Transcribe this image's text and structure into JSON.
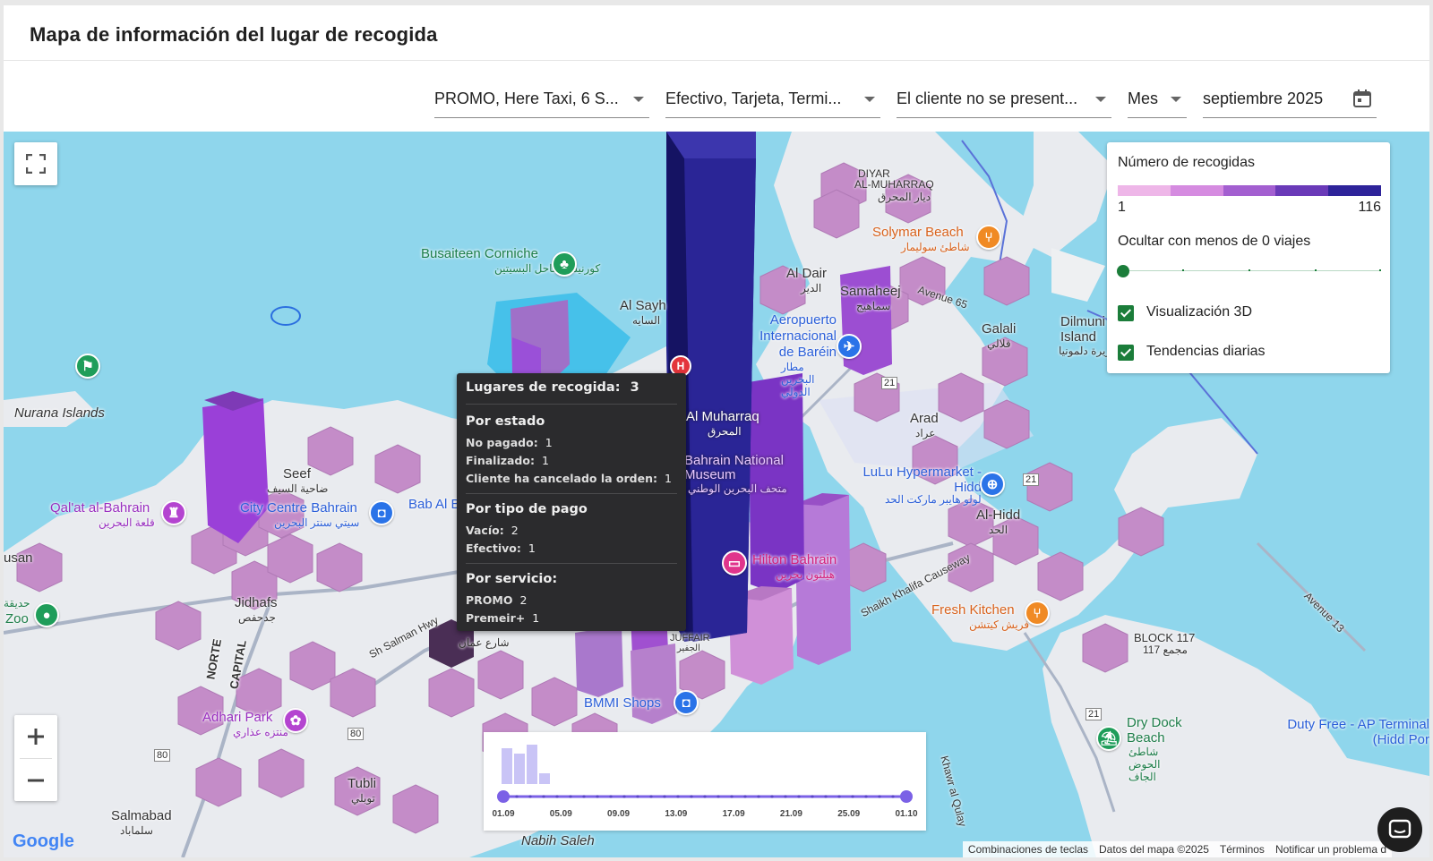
{
  "title": "Mapa de información del lugar de recogida",
  "filters": {
    "service": "PROMO, Here Taxi, 6 S...",
    "payment": "Efectivo, Tarjeta, Termi...",
    "status": "El cliente no se present...",
    "period": "Mes",
    "date": "septiembre 2025",
    "calendar_icon": "calendar-icon"
  },
  "legend": {
    "title": "Número de recogidas",
    "min": "1",
    "max": "116",
    "colors": [
      "#eeb6e8",
      "#d58be0",
      "#a35fd0",
      "#6a3ab8",
      "#2e239a"
    ],
    "hide_label": "Ocultar con menos de 0 viajes",
    "min_trips_value": 0,
    "toggle_3d": "Visualización 3D",
    "toggle_3d_checked": true,
    "toggle_trends": "Tendencias diarias",
    "toggle_trends_checked": true
  },
  "tooltip": {
    "places_label": "Lugares de recogida:",
    "places_value": "3",
    "by_status_title": "Por estado",
    "status": [
      {
        "label": "No pagado:",
        "value": "1"
      },
      {
        "label": "Finalizado:",
        "value": "1"
      },
      {
        "label": "Cliente ha cancelado la orden:",
        "value": "1"
      }
    ],
    "by_payment_title": "Por tipo de pago",
    "payment": [
      {
        "label": "Vacío:",
        "value": "2"
      },
      {
        "label": "Efectivo:",
        "value": "1"
      }
    ],
    "by_service_title": "Por servicio:",
    "service": [
      {
        "label": "PROMO",
        "value": "2"
      },
      {
        "label": "Premeir+",
        "value": "1"
      }
    ]
  },
  "timeline": {
    "ticks": [
      "01.09",
      "05.09",
      "09.09",
      "13.09",
      "17.09",
      "21.09",
      "25.09",
      "01.10"
    ],
    "range_start": "01.09",
    "range_end": "01.10",
    "accent": "#7b61e6"
  },
  "map_labels": {
    "diyar": "DIYAR",
    "al_muharraq_district": "AL-MUHARRAQ",
    "diyar_ar": "ديار المحرق",
    "solymar": "Solymar Beach",
    "solymar_ar": "شاطئ سوليمار",
    "busaiteen": "Busaiteen Corniche",
    "busaiteen_ar": "كورنيش ساحل البسيتين",
    "al_dair": "Al Dair",
    "al_dair_ar": "الدير",
    "samaheej": "Samaheej",
    "samaheej_ar": "سماهيج",
    "avenue65": "Avenue 65",
    "al_sayh": "Al Sayh",
    "al_sayh_ar": "السايه",
    "airport": "Aeropuerto Internacional de Baréin",
    "airport_ar": "مطار البحرين الدولي",
    "galali": "Galali",
    "galali_ar": "قلالي",
    "dilmunia": "Dilmuni Island",
    "dilmunia_ar": "جزيرة دلمونيا",
    "nurana": "Nurana Islands",
    "al_muharraq": "Al Muharraq",
    "al_muharraq_ar": "المحرق",
    "arad": "Arad",
    "arad_ar": "عراد",
    "museum": "Bahrain National Museum",
    "museum_ar": "متحف البحرين الوطني",
    "lulu": "LuLu Hypermarket - Hidd",
    "lulu_ar": "لولو هايبر ماركت الحد",
    "seef": "Seef",
    "seef_ar": "ضاحية السيف",
    "qalat": "Qal'at al-Bahrain",
    "qalat_ar": "قلعة البحرين",
    "city_centre": "City Centre Bahrain",
    "city_centre_ar": "سيتي سنتر البحرين",
    "bab": "Bab Al B",
    "al_hidd": "Al-Hidd",
    "al_hidd_ar": "الحد",
    "usan": "usan",
    "hilton": "Hilton Bahrain",
    "hilton_ar": "هيلتون بحرين",
    "causeway": "Shaikh Khalifa Causeway",
    "zoo": "Zoo",
    "zoo_ar": "حديقة",
    "jidhafs": "Jidhafs",
    "jidhafs_ar": "جدحفص",
    "salman_hwy": "Sh Salman Hwy",
    "oman_st": "شارع عمان",
    "fresh_kitchen": "Fresh Kitchen",
    "fresh_kitchen_ar": "فريش كيتشن",
    "block117": "BLOCK 117",
    "block117_ar": "مجمع 117",
    "avenue13": "Avenue 13",
    "norte": "NORTE",
    "capital": "CAPITAL",
    "juffair": "JUFFAIR",
    "juffair_ar": "الجفير",
    "adhari": "Adhari Park",
    "adhari_ar": "منتزه عذاري",
    "bmmi": "BMMI Shops",
    "dry_dock": "Dry Dock Beach",
    "dry_dock_ar": "شاطئ الحوض الجاف",
    "duty_free": "Duty Free - AP Terminal (Hidd Por",
    "tubli": "Tubli",
    "tubli_ar": "توبلي",
    "salmabad": "Salmabad",
    "salmabad_ar": "سلماباد",
    "nabih": "Nabih Saleh",
    "khawr": "Khawr al Qulay",
    "route21a": "21",
    "route21b": "21",
    "route21c": "21",
    "route80a": "80",
    "route80b": "80"
  },
  "footer": {
    "google": "Google",
    "shortcuts": "Combinaciones de teclas",
    "map_data": "Datos del mapa ©2025",
    "terms": "Términos",
    "report": "Notificar un problema d"
  }
}
